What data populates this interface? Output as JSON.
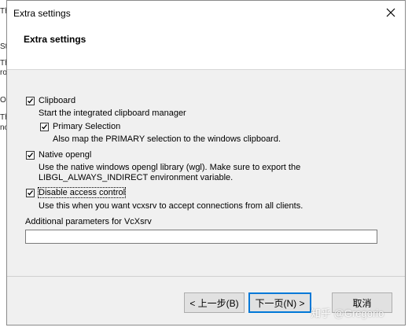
{
  "background_window": {
    "fragments": [
      "Th",
      "St",
      "Th",
      "ro",
      "Op",
      "Th",
      "no"
    ]
  },
  "window": {
    "title": "Extra settings",
    "close_label": "✕"
  },
  "header": {
    "title": "Extra settings"
  },
  "options": {
    "clipboard": {
      "label": "Clipboard",
      "checked": true,
      "description": "Start the integrated clipboard manager"
    },
    "primary_selection": {
      "label": "Primary Selection",
      "checked": true,
      "description": "Also map the PRIMARY selection to the windows clipboard."
    },
    "native_opengl": {
      "label": "Native opengl",
      "checked": true,
      "description_lines": [
        "Use the native windows opengl library (wgl). Make sure to export the",
        "LIBGL_ALWAYS_INDIRECT environment variable."
      ]
    },
    "disable_access_control": {
      "label": "Disable access control",
      "checked": true,
      "description": "Use this when you want vcxsrv to accept connections from all clients."
    }
  },
  "params": {
    "label": "Additional parameters for VcXsrv",
    "value": "",
    "placeholder": ""
  },
  "buttons": {
    "back": "< 上一步(B)",
    "next": "下一页(N) >",
    "cancel": "取消"
  },
  "watermark": "知乎 @Gregorio",
  "colors": {
    "dialog_bg": "#f0f0f0",
    "focus_blue": "#0078d7"
  }
}
